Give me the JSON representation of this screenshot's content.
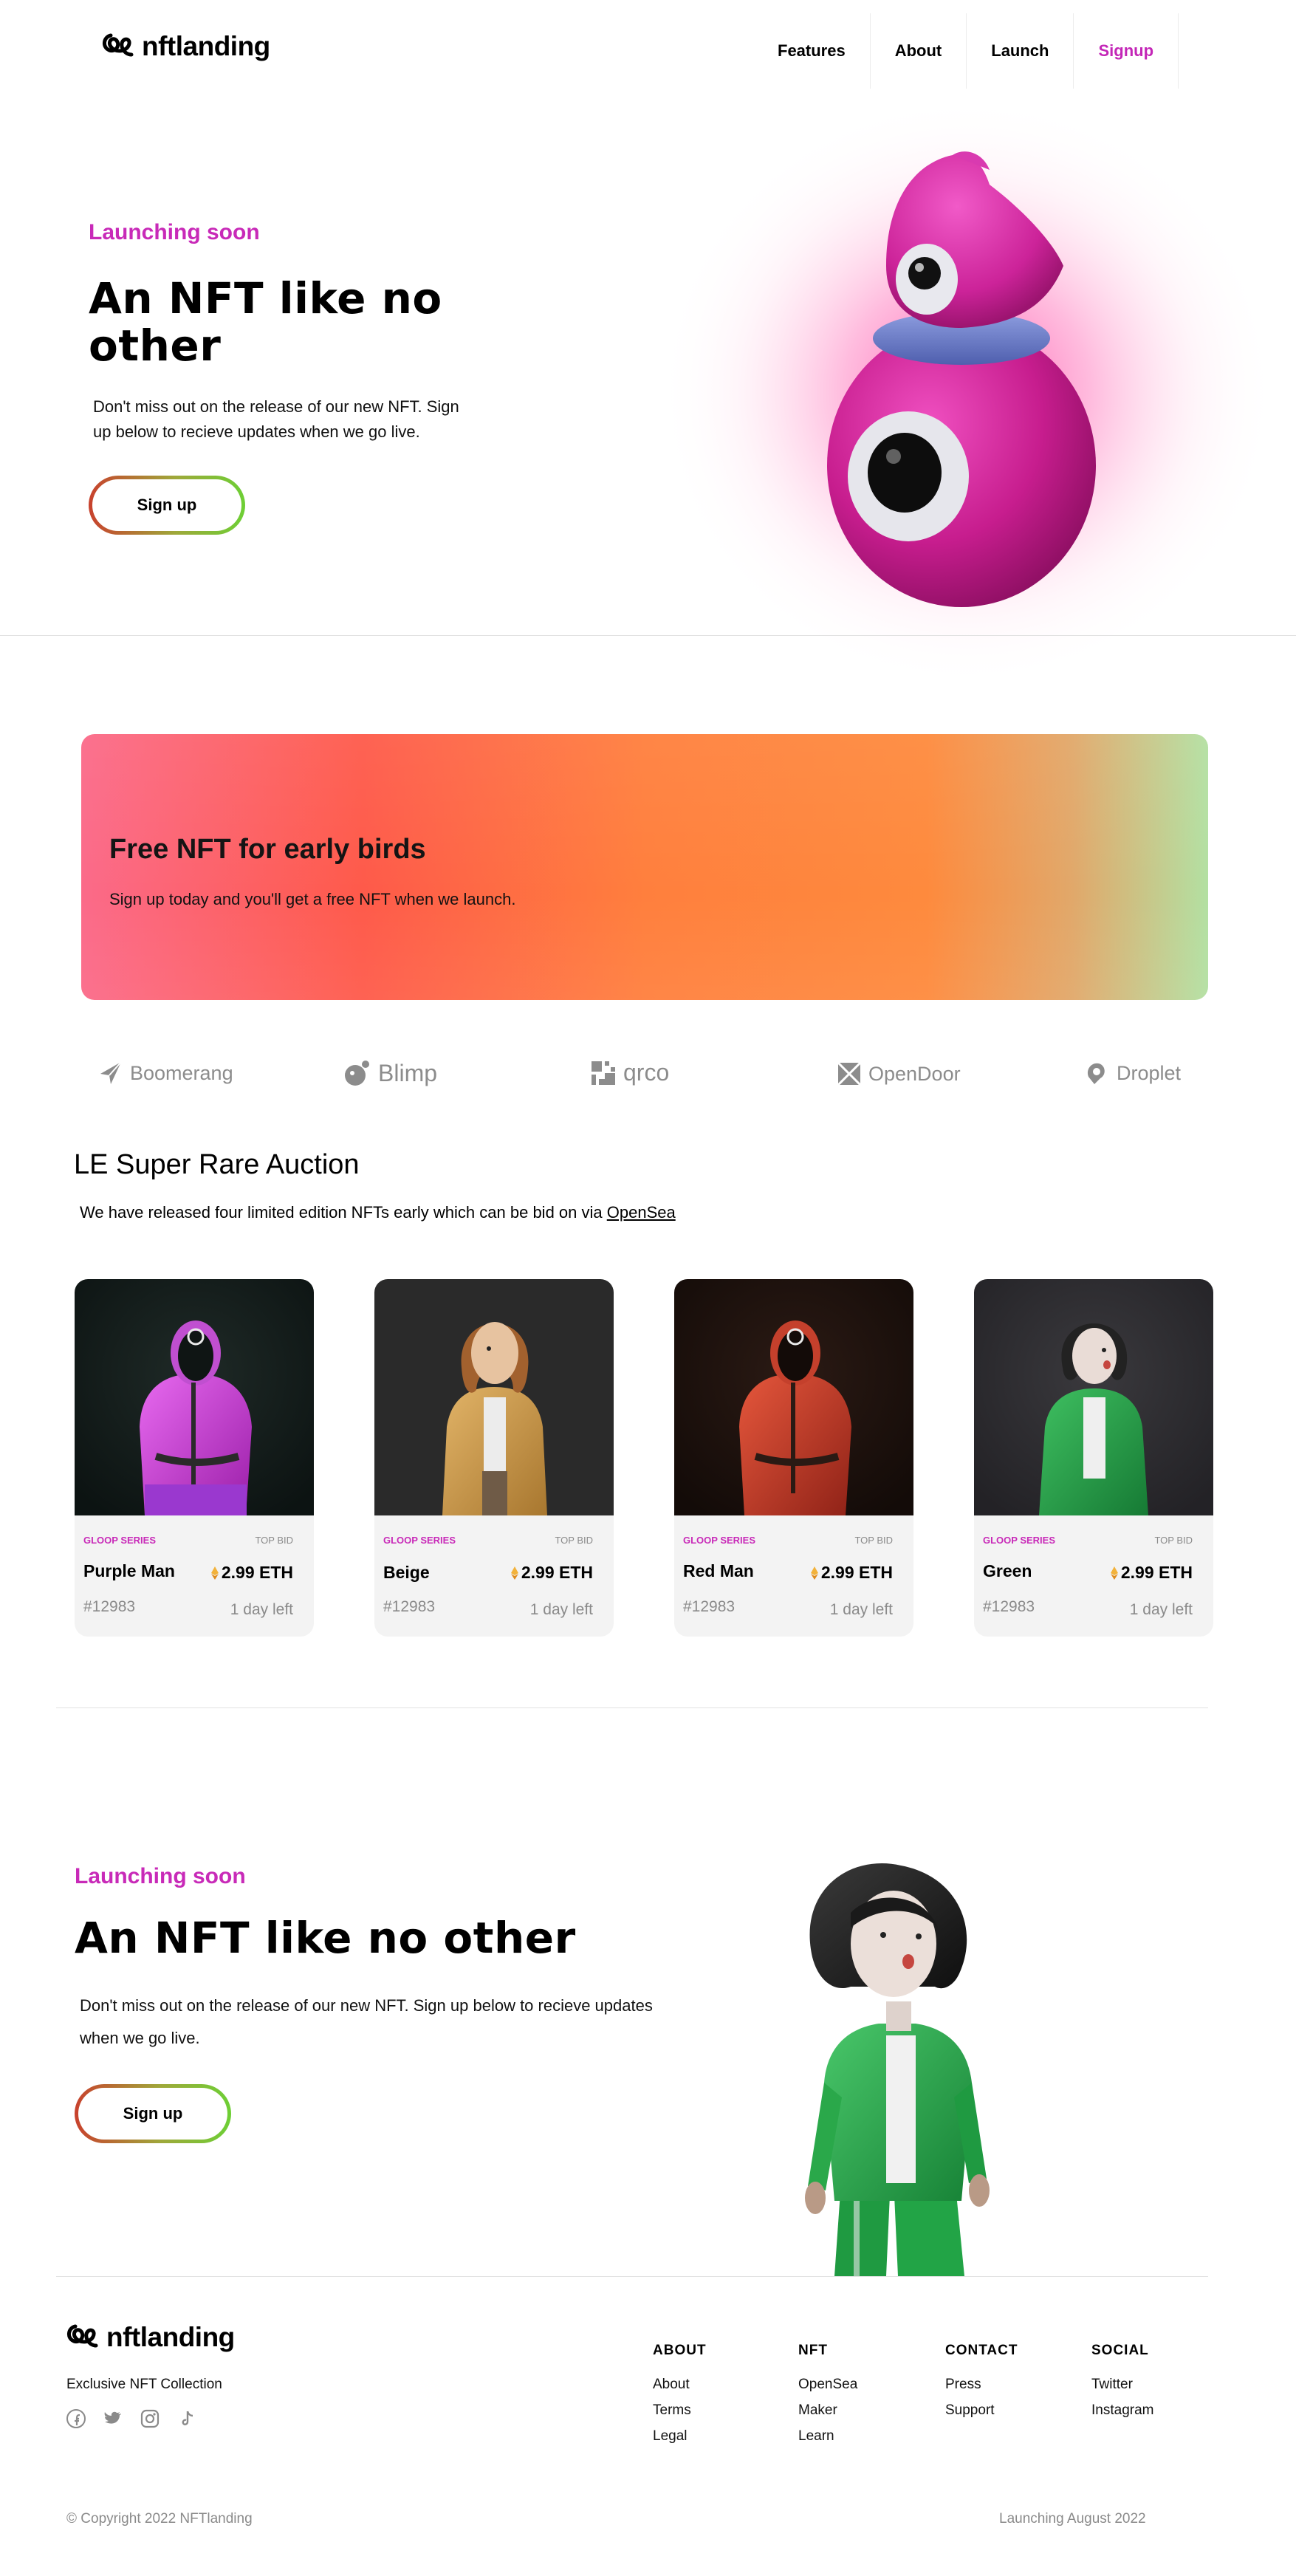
{
  "header": {
    "logo_text": "nftlanding",
    "nav": [
      {
        "label": "Features"
      },
      {
        "label": "About"
      },
      {
        "label": "Launch"
      },
      {
        "label": "Signup"
      }
    ]
  },
  "hero": {
    "kicker": "Launching soon",
    "title_line1": "An NFT like no",
    "title_line2": "other",
    "text_line1": "Don't miss out on the release of our new NFT. Sign",
    "text_line2": "up below to recieve updates when we go live.",
    "button": "Sign up"
  },
  "banner": {
    "title": "Free NFT for early birds",
    "text": "Sign up today and you'll get a free NFT when we launch."
  },
  "partners": [
    {
      "name": "Boomerang",
      "icon": "boomerang-icon"
    },
    {
      "name": "Blimp",
      "icon": "blimp-icon"
    },
    {
      "name": "qrco",
      "icon": "qrco-icon"
    },
    {
      "name": "OpenDoor",
      "icon": "opendoor-icon"
    },
    {
      "name": "Droplet",
      "icon": "droplet-icon"
    }
  ],
  "auction": {
    "title": "LE Super Rare Auction",
    "text": "We have released four limited edition NFTs early which can be bid on via",
    "link": "OpenSea",
    "cards": [
      {
        "series": "GLOOP SERIES",
        "top_bid_label": "TOP BID",
        "name": "Purple Man",
        "price": "2.99 ETH",
        "id": "#12983",
        "time_left": "1 day left"
      },
      {
        "series": "GLOOP SERIES",
        "top_bid_label": "TOP BID",
        "name": "Beige",
        "price": "2.99 ETH",
        "id": "#12983",
        "time_left": "1 day left"
      },
      {
        "series": "GLOOP SERIES",
        "top_bid_label": "TOP BID",
        "name": "Red Man",
        "price": "2.99 ETH",
        "id": "#12983",
        "time_left": "1 day left"
      },
      {
        "series": "GLOOP SERIES",
        "top_bid_label": "TOP BID",
        "name": "Green",
        "price": "2.99 ETH",
        "id": "#12983",
        "time_left": "1 day left"
      }
    ]
  },
  "launch": {
    "kicker": "Launching soon",
    "title": "An NFT like no other",
    "text_line1": "Don't miss out on the release of our new NFT. Sign up below to recieve updates",
    "text_line2": "when we go live.",
    "button": "Sign up"
  },
  "footer": {
    "logo_text": "nftlanding",
    "tagline": "Exclusive NFT Collection",
    "social_icons": [
      "facebook-icon",
      "twitter-icon",
      "instagram-icon",
      "tiktok-icon"
    ],
    "columns": [
      {
        "heading": "ABOUT",
        "links": [
          "About",
          "Terms",
          "Legal"
        ]
      },
      {
        "heading": "NFT",
        "links": [
          "OpenSea",
          "Maker",
          "Learn"
        ]
      },
      {
        "heading": "CONTACT",
        "links": [
          "Press",
          "Support"
        ]
      },
      {
        "heading": "SOCIAL",
        "links": [
          "Twitter",
          "Instagram"
        ]
      }
    ],
    "copyright": "© Copyright 2022 NFTlanding",
    "launch_note": "Launching August 2022"
  },
  "colors": {
    "accent": "#c82ab8",
    "muted": "#8a8a8a"
  }
}
